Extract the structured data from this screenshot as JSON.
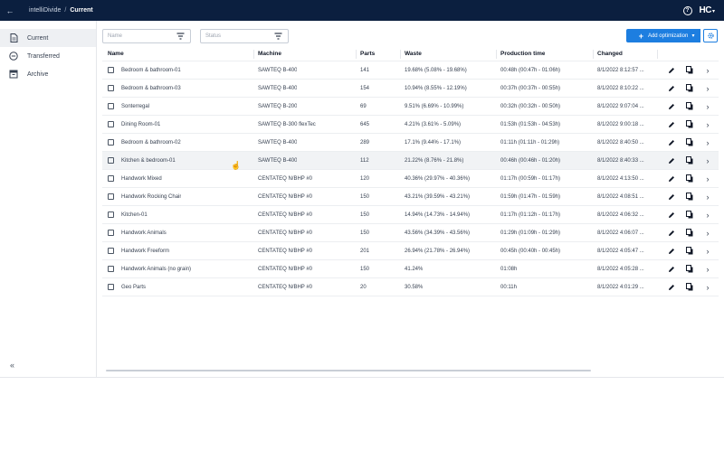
{
  "topbar": {
    "app_name": "intelliDivide",
    "separator": "/",
    "current": "Current",
    "help_glyph": "?",
    "brand": "HC"
  },
  "sidebar": {
    "items": [
      {
        "label": "Current",
        "icon": "document-icon",
        "active": true
      },
      {
        "label": "Transferred",
        "icon": "transfer-icon",
        "active": false
      },
      {
        "label": "Archive",
        "icon": "archive-icon",
        "active": false
      }
    ],
    "collapse_glyph": "«"
  },
  "filters": {
    "name_placeholder": "Name",
    "status_placeholder": "Status"
  },
  "toolbar": {
    "add_label": "Add optimization",
    "add_glyph": "+",
    "caret_glyph": "▾"
  },
  "table": {
    "headers": [
      "Name",
      "Machine",
      "Parts",
      "Waste",
      "Production time",
      "Changed"
    ],
    "rows": [
      {
        "name": "Bedroom & bathroom-01",
        "machine": "SAWTEQ B-400",
        "parts": "141",
        "waste": "19.68% (5.08% - 19.68%)",
        "time": "00:48h (00:47h - 01:06h)",
        "changed": "8/1/2022 8:12:57 ..."
      },
      {
        "name": "Bedroom & bathroom-03",
        "machine": "SAWTEQ B-400",
        "parts": "154",
        "waste": "10.94% (8.55% - 12.19%)",
        "time": "00:37h (00:37h - 00:55h)",
        "changed": "8/1/2022 8:10:22 ..."
      },
      {
        "name": "Sonterregal",
        "machine": "SAWTEQ B-200",
        "parts": "69",
        "waste": "9.51% (6.69% - 10.99%)",
        "time": "00:32h (00:32h - 00:50h)",
        "changed": "8/1/2022 9:07:04 ..."
      },
      {
        "name": "Dining Room-01",
        "machine": "SAWTEQ B-300 flexTec",
        "parts": "645",
        "waste": "4.21% (3.61% - 5.09%)",
        "time": "01:53h (01:53h - 04:53h)",
        "changed": "8/1/2022 9:00:18 ..."
      },
      {
        "name": "Bedroom & bathroom-02",
        "machine": "SAWTEQ B-400",
        "parts": "289",
        "waste": "17.1% (9.44% - 17.1%)",
        "time": "01:11h (01:11h - 01:29h)",
        "changed": "8/1/2022 8:40:50 ..."
      },
      {
        "name": "Kitchen & bedroom-01",
        "machine": "SAWTEQ B-400",
        "parts": "112",
        "waste": "21.22% (8.76% - 21.8%)",
        "time": "00:46h (00:46h - 01:20h)",
        "changed": "8/1/2022 8:40:33 ..."
      },
      {
        "name": "Handwork Mixed",
        "machine": "CENTATEQ N/BHP #0",
        "parts": "120",
        "waste": "40.36% (29.97% - 40.36%)",
        "time": "01:17h (00:59h - 01:17h)",
        "changed": "8/1/2022 4:13:50 ..."
      },
      {
        "name": "Handwork Rocking Chair",
        "machine": "CENTATEQ N/BHP #0",
        "parts": "150",
        "waste": "43.21% (39.59% - 43.21%)",
        "time": "01:59h (01:47h - 01:59h)",
        "changed": "8/1/2022 4:08:51 ..."
      },
      {
        "name": "Kitchen-01",
        "machine": "CENTATEQ N/BHP #0",
        "parts": "150",
        "waste": "14.94% (14.73% - 14.94%)",
        "time": "01:17h (01:12h - 01:17h)",
        "changed": "8/1/2022 4:06:32 ..."
      },
      {
        "name": "Handwork Animals",
        "machine": "CENTATEQ N/BHP #0",
        "parts": "150",
        "waste": "43.56% (34.39% - 43.56%)",
        "time": "01:29h (01:09h - 01:29h)",
        "changed": "8/1/2022 4:06:07 ..."
      },
      {
        "name": "Handwork Freeform",
        "machine": "CENTATEQ N/BHP #0",
        "parts": "201",
        "waste": "26.94% (21.78% - 26.94%)",
        "time": "00:45h (00:40h - 00:45h)",
        "changed": "8/1/2022 4:05:47 ..."
      },
      {
        "name": "Handwork Animals (no grain)",
        "machine": "CENTATEQ N/BHP #0",
        "parts": "150",
        "waste": "41.24%",
        "time": "01:08h",
        "changed": "8/1/2022 4:05:28 ..."
      },
      {
        "name": "Geo Parts",
        "machine": "CENTATEQ N/BHP #0",
        "parts": "20",
        "waste": "30.58%",
        "time": "00:11h",
        "changed": "8/1/2022 4:01:29 ..."
      }
    ],
    "hover_row_index": 5
  },
  "colors": {
    "topbar": "#0b1f3f",
    "accent": "#1d7ee0"
  }
}
